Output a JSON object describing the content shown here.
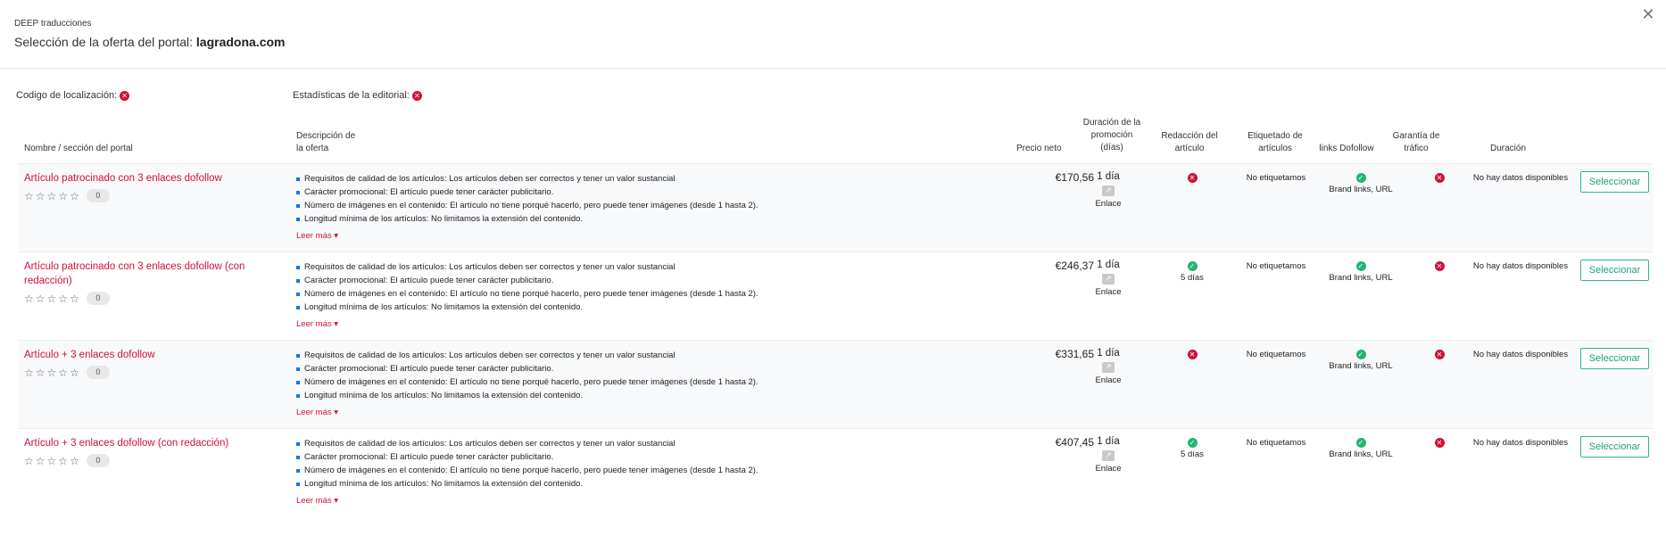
{
  "header": {
    "brand": "DEEP traducciones",
    "title_prefix": "Selección de la oferta del portal: ",
    "portal": "lagradona.com",
    "close_glyph": "✕"
  },
  "filters": {
    "location_label": "Codigo de localización:",
    "stats_label": "Estadísticas de la editorial:"
  },
  "columns": {
    "name": "Nombre / sección del portal",
    "desc_1": "Descripción de",
    "desc_2": "la oferta",
    "price": "Precio neto",
    "promo_1": "Duración de la",
    "promo_2": "promoción",
    "promo_3": "(días)",
    "writing_1": "Redacción del",
    "writing_2": "artículo",
    "tagging_1": "Etiquetado de",
    "tagging_2": "artículos",
    "dofollow": "links Dofollow",
    "traffic_1": "Garantía de",
    "traffic_2": "tráfico",
    "duration": "Duración"
  },
  "icons": {
    "not_available": "x-circle-icon",
    "available": "check-circle-icon",
    "link": "external-link-icon",
    "star": "star-outline-icon"
  },
  "colors": {
    "accent_red": "#d0103a",
    "success_green": "#22b573",
    "button_green": "#2bb58f",
    "bullet_blue": "#1a73e8"
  },
  "offers": [
    {
      "name": "Artículo patrocinado con 3 enlaces dofollow",
      "rating_count": "0",
      "desc": [
        "Requisitos de calidad de los artículos: Los artículos deben ser correctos y tener un valor sustancial",
        "Carácter promocional: El artículo puede tener carácter publicitario.",
        "Número de imágenes en el contenido: El artículo no tiene porqué hacerlo, pero puede tener imágenes (desde 1 hasta 2).",
        "Longitud mínima de los artículos: No limitamos la extensión del contenido."
      ],
      "read_more": "Leer más ▾",
      "price": "€170,56",
      "promo_duration": "1 día",
      "link_label": "Enlace",
      "writing_included": false,
      "writing_time": "",
      "tagging": "No etiquetamos",
      "dofollow_types": "Brand links, URL",
      "traffic_guarantee": false,
      "duration": "No hay datos disponibles",
      "select_label": "Seleccionar"
    },
    {
      "name": "Artículo patrocinado con 3 enlaces dofollow (con redacción)",
      "rating_count": "0",
      "desc": [
        "Requisitos de calidad de los artículos: Los artículos deben ser correctos y tener un valor sustancial",
        "Carácter promocional: El artículo puede tener carácter publicitario.",
        "Número de imágenes en el contenido: El artículo no tiene porqué hacerlo, pero puede tener imágenes (desde 1 hasta 2).",
        "Longitud mínima de los artículos: No limitamos la extensión del contenido."
      ],
      "read_more": "Leer más ▾",
      "price": "€246,37",
      "promo_duration": "1 día",
      "link_label": "Enlace",
      "writing_included": true,
      "writing_time": "5 días",
      "tagging": "No etiquetamos",
      "dofollow_types": "Brand links, URL",
      "traffic_guarantee": false,
      "duration": "No hay datos disponibles",
      "select_label": "Seleccionar"
    },
    {
      "name": "Artículo + 3 enlaces dofollow",
      "rating_count": "0",
      "desc": [
        "Requisitos de calidad de los artículos: Los artículos deben ser correctos y tener un valor sustancial",
        "Carácter promocional: El artículo puede tener carácter publicitario.",
        "Número de imágenes en el contenido: El artículo no tiene porqué hacerlo, pero puede tener imágenes (desde 1 hasta 2).",
        "Longitud mínima de los artículos: No limitamos la extensión del contenido."
      ],
      "read_more": "Leer más ▾",
      "price": "€331,65",
      "promo_duration": "1 día",
      "link_label": "Enlace",
      "writing_included": false,
      "writing_time": "",
      "tagging": "No etiquetamos",
      "dofollow_types": "Brand links, URL",
      "traffic_guarantee": false,
      "duration": "No hay datos disponibles",
      "select_label": "Seleccionar"
    },
    {
      "name": "Artículo + 3 enlaces dofollow (con redacción)",
      "rating_count": "0",
      "desc": [
        "Requisitos de calidad de los artículos: Los artículos deben ser correctos y tener un valor sustancial",
        "Carácter promocional: El artículo puede tener carácter publicitario.",
        "Número de imágenes en el contenido: El artículo no tiene porqué hacerlo, pero puede tener imágenes (desde 1 hasta 2).",
        "Longitud mínima de los artículos: No limitamos la extensión del contenido."
      ],
      "read_more": "Leer más ▾",
      "price": "€407,45",
      "promo_duration": "1 día",
      "link_label": "Enlace",
      "writing_included": true,
      "writing_time": "5 días",
      "tagging": "No etiquetamos",
      "dofollow_types": "Brand links, URL",
      "traffic_guarantee": false,
      "duration": "No hay datos disponibles",
      "select_label": "Seleccionar"
    }
  ]
}
